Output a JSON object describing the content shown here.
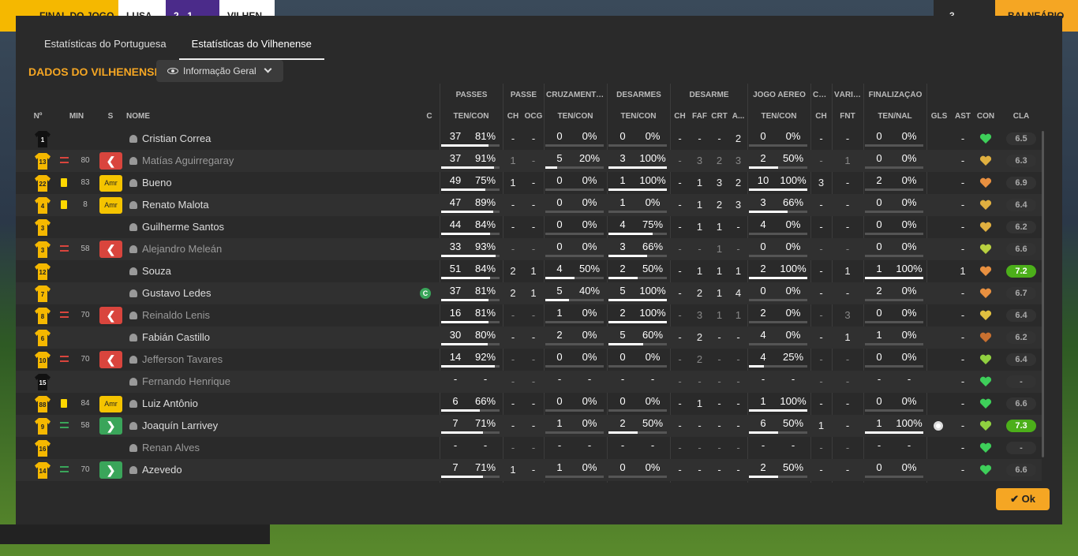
{
  "topbar": {
    "status": "FINAL DO JOGO",
    "home": "LUSA",
    "score": "2 - 1",
    "away": "VILHEN",
    "right_button": "BALNEÁRIO",
    "count": "3"
  },
  "tabs": [
    {
      "label": "Estatísticas do Portuguesa"
    },
    {
      "label": "Estatísticas do Vilhenense"
    }
  ],
  "section_title": "DADOS DO VILHENENSE",
  "view_select": {
    "label": "Informação Geral"
  },
  "ok_label": "Ok",
  "headers": {
    "no": "Nº",
    "min": "MIN",
    "s": "S",
    "nome": "NOME",
    "c": "C",
    "groups": [
      "PASSES",
      "PASSE",
      "CRUZAMENTOS",
      "DESARMES",
      "DESARME",
      "JOGO AÉREO",
      "CA...",
      "VÁRIOS",
      "FINALIZAÇÃO"
    ],
    "sub": [
      "TEN/CON",
      "CH",
      "OCG",
      "TEN/CON",
      "TEN/CON",
      "CH",
      "FAF",
      "CRT",
      "A...",
      "TEN/CON",
      "CH",
      "FNT",
      "TEN/NAL",
      "GLS",
      "AST",
      "CON",
      "CLA"
    ]
  },
  "players": [
    {
      "no": "1",
      "gk": true,
      "sub": "",
      "min": "",
      "s": "",
      "name": "Cristian Correa",
      "dim": false,
      "c": false,
      "pass": [
        "37",
        "81%",
        0.81
      ],
      "ch": "-",
      "ocg": "-",
      "cross": [
        "0",
        "0%",
        0
      ],
      "tack": [
        "0",
        "0%",
        0
      ],
      "dch": "-",
      "faf": "-",
      "crt": "-",
      "a": "2",
      "air": [
        "0",
        "0%",
        0
      ],
      "ca": "-",
      "fnt": "-",
      "fin": [
        "0",
        "0%",
        0
      ],
      "gls": "",
      "ast": "-",
      "con": "#3ecf5a",
      "cla": "6.5",
      "hi": false
    },
    {
      "no": "13",
      "gk": false,
      "sub": "out",
      "min": "80",
      "s": "out",
      "name": "Matías Aguirregaray",
      "dim": true,
      "c": false,
      "pass": [
        "37",
        "91%",
        0.91
      ],
      "ch": "1",
      "ocg": "-",
      "cross": [
        "5",
        "20%",
        0.2
      ],
      "tack": [
        "3",
        "100%",
        1
      ],
      "dch": "-",
      "faf": "3",
      "crt": "2",
      "a": "3",
      "air": [
        "2",
        "50%",
        0.5
      ],
      "ca": "-",
      "fnt": "1",
      "fin": [
        "0",
        "0%",
        0
      ],
      "gls": "",
      "ast": "-",
      "con": "#e0b040",
      "cla": "6.3",
      "hi": false
    },
    {
      "no": "22",
      "gk": false,
      "sub": "yellow",
      "min": "83",
      "s": "amr",
      "name": "Bueno",
      "dim": false,
      "c": false,
      "pass": [
        "49",
        "75%",
        0.75
      ],
      "ch": "1",
      "ocg": "-",
      "cross": [
        "0",
        "0%",
        0
      ],
      "tack": [
        "1",
        "100%",
        1
      ],
      "dch": "-",
      "faf": "1",
      "crt": "3",
      "a": "2",
      "air": [
        "10",
        "100%",
        1
      ],
      "ca": "3",
      "fnt": "-",
      "fin": [
        "2",
        "0%",
        0
      ],
      "gls": "",
      "ast": "-",
      "con": "#e89040",
      "cla": "6.9",
      "hi": false
    },
    {
      "no": "4",
      "gk": false,
      "sub": "yellow",
      "min": "8",
      "s": "amr",
      "name": "Renato Malota",
      "dim": false,
      "c": false,
      "pass": [
        "47",
        "89%",
        0.89
      ],
      "ch": "-",
      "ocg": "-",
      "cross": [
        "0",
        "0%",
        0
      ],
      "tack": [
        "1",
        "0%",
        0
      ],
      "dch": "-",
      "faf": "1",
      "crt": "2",
      "a": "3",
      "air": [
        "3",
        "66%",
        0.66
      ],
      "ca": "-",
      "fnt": "-",
      "fin": [
        "0",
        "0%",
        0
      ],
      "gls": "",
      "ast": "-",
      "con": "#e0b040",
      "cla": "6.4",
      "hi": false
    },
    {
      "no": "3",
      "gk": false,
      "sub": "",
      "min": "",
      "s": "",
      "name": "Guilherme Santos",
      "dim": false,
      "c": false,
      "pass": [
        "44",
        "84%",
        0.84
      ],
      "ch": "-",
      "ocg": "-",
      "cross": [
        "0",
        "0%",
        0
      ],
      "tack": [
        "4",
        "75%",
        0.75
      ],
      "dch": "-",
      "faf": "1",
      "crt": "1",
      "a": "-",
      "air": [
        "4",
        "0%",
        0
      ],
      "ca": "-",
      "fnt": "-",
      "fin": [
        "0",
        "0%",
        0
      ],
      "gls": "",
      "ast": "-",
      "con": "#e0b040",
      "cla": "6.2",
      "hi": false
    },
    {
      "no": "3",
      "gk": false,
      "sub": "out",
      "min": "58",
      "s": "out",
      "name": "Alejandro Meleán",
      "dim": true,
      "c": false,
      "pass": [
        "33",
        "93%",
        0.93
      ],
      "ch": "-",
      "ocg": "-",
      "cross": [
        "0",
        "0%",
        0
      ],
      "tack": [
        "3",
        "66%",
        0.66
      ],
      "dch": "-",
      "faf": "-",
      "crt": "1",
      "a": "-",
      "air": [
        "0",
        "0%",
        0
      ],
      "ca": "-",
      "fnt": "-",
      "fin": [
        "0",
        "0%",
        0
      ],
      "gls": "",
      "ast": "-",
      "con": "#b8d040",
      "cla": "6.6",
      "hi": false
    },
    {
      "no": "12",
      "gk": false,
      "sub": "",
      "min": "",
      "s": "",
      "name": "Souza",
      "dim": false,
      "c": false,
      "pass": [
        "51",
        "84%",
        0.84
      ],
      "ch": "2",
      "ocg": "1",
      "cross": [
        "4",
        "50%",
        0.5
      ],
      "tack": [
        "2",
        "50%",
        0.5
      ],
      "dch": "-",
      "faf": "1",
      "crt": "1",
      "a": "1",
      "air": [
        "2",
        "100%",
        1
      ],
      "ca": "-",
      "fnt": "1",
      "fin": [
        "1",
        "100%",
        1
      ],
      "gls": "",
      "ast": "1",
      "con": "#e89040",
      "cla": "7.2",
      "hi": true
    },
    {
      "no": "7",
      "gk": false,
      "sub": "",
      "min": "",
      "s": "",
      "name": "Gustavo Ledes",
      "dim": false,
      "c": true,
      "pass": [
        "37",
        "81%",
        0.81
      ],
      "ch": "2",
      "ocg": "1",
      "cross": [
        "5",
        "40%",
        0.4
      ],
      "tack": [
        "5",
        "100%",
        1
      ],
      "dch": "-",
      "faf": "2",
      "crt": "1",
      "a": "4",
      "air": [
        "0",
        "0%",
        0
      ],
      "ca": "-",
      "fnt": "-",
      "fin": [
        "2",
        "0%",
        0
      ],
      "gls": "",
      "ast": "-",
      "con": "#e89040",
      "cla": "6.7",
      "hi": false
    },
    {
      "no": "8",
      "gk": false,
      "sub": "out",
      "min": "70",
      "s": "out",
      "name": "Reinaldo Lenis",
      "dim": true,
      "c": false,
      "pass": [
        "16",
        "81%",
        0.81
      ],
      "ch": "-",
      "ocg": "-",
      "cross": [
        "1",
        "0%",
        0
      ],
      "tack": [
        "2",
        "100%",
        1
      ],
      "dch": "-",
      "faf": "3",
      "crt": "1",
      "a": "1",
      "air": [
        "2",
        "0%",
        0
      ],
      "ca": "-",
      "fnt": "3",
      "fin": [
        "0",
        "0%",
        0
      ],
      "gls": "",
      "ast": "-",
      "con": "#e0c040",
      "cla": "6.4",
      "hi": false
    },
    {
      "no": "6",
      "gk": false,
      "sub": "",
      "min": "",
      "s": "",
      "name": "Fabián Castillo",
      "dim": false,
      "c": false,
      "pass": [
        "30",
        "80%",
        0.8
      ],
      "ch": "-",
      "ocg": "-",
      "cross": [
        "2",
        "0%",
        0
      ],
      "tack": [
        "5",
        "60%",
        0.6
      ],
      "dch": "-",
      "faf": "2",
      "crt": "-",
      "a": "-",
      "air": [
        "4",
        "0%",
        0
      ],
      "ca": "-",
      "fnt": "1",
      "fin": [
        "1",
        "0%",
        0
      ],
      "gls": "",
      "ast": "-",
      "con": "#c87030",
      "cla": "6.2",
      "hi": false
    },
    {
      "no": "10",
      "gk": false,
      "sub": "out",
      "min": "70",
      "s": "out",
      "name": "Jefferson Tavares",
      "dim": true,
      "c": false,
      "pass": [
        "14",
        "92%",
        0.92
      ],
      "ch": "-",
      "ocg": "-",
      "cross": [
        "0",
        "0%",
        0
      ],
      "tack": [
        "0",
        "0%",
        0
      ],
      "dch": "-",
      "faf": "2",
      "crt": "-",
      "a": "-",
      "air": [
        "4",
        "25%",
        0.25
      ],
      "ca": "-",
      "fnt": "-",
      "fin": [
        "0",
        "0%",
        0
      ],
      "gls": "",
      "ast": "-",
      "con": "#90d040",
      "cla": "6.4",
      "hi": false
    },
    {
      "no": "15",
      "gk": true,
      "sub": "",
      "min": "",
      "s": "",
      "name": "Fernando Henrique",
      "dim": true,
      "c": false,
      "pass": [
        "-",
        "-",
        -1
      ],
      "ch": "-",
      "ocg": "-",
      "cross": [
        "-",
        "-",
        -1
      ],
      "tack": [
        "-",
        "-",
        -1
      ],
      "dch": "-",
      "faf": "-",
      "crt": "-",
      "a": "-",
      "air": [
        "-",
        "-",
        -1
      ],
      "ca": "-",
      "fnt": "-",
      "fin": [
        "-",
        "-",
        -1
      ],
      "gls": "",
      "ast": "-",
      "con": "#3ecf5a",
      "cla": "-",
      "hi": false
    },
    {
      "no": "88",
      "gk": false,
      "sub": "yellow",
      "min": "84",
      "s": "amr",
      "name": "Luiz Antônio",
      "dim": false,
      "c": false,
      "pass": [
        "6",
        "66%",
        0.66
      ],
      "ch": "-",
      "ocg": "-",
      "cross": [
        "0",
        "0%",
        0
      ],
      "tack": [
        "0",
        "0%",
        0
      ],
      "dch": "-",
      "faf": "1",
      "crt": "-",
      "a": "-",
      "air": [
        "1",
        "100%",
        1
      ],
      "ca": "-",
      "fnt": "-",
      "fin": [
        "0",
        "0%",
        0
      ],
      "gls": "",
      "ast": "-",
      "con": "#3ecf5a",
      "cla": "6.6",
      "hi": false
    },
    {
      "no": "9",
      "gk": false,
      "sub": "in",
      "min": "58",
      "s": "in",
      "name": "Joaquín Larrivey",
      "dim": false,
      "c": false,
      "pass": [
        "7",
        "71%",
        0.71
      ],
      "ch": "-",
      "ocg": "-",
      "cross": [
        "1",
        "0%",
        0
      ],
      "tack": [
        "2",
        "50%",
        0.5
      ],
      "dch": "-",
      "faf": "-",
      "crt": "-",
      "a": "-",
      "air": [
        "6",
        "50%",
        0.5
      ],
      "ca": "1",
      "fnt": "-",
      "fin": [
        "1",
        "100%",
        1
      ],
      "gls": "ball",
      "ast": "-",
      "con": "#90d040",
      "cla": "7.3",
      "hi": true
    },
    {
      "no": "16",
      "gk": false,
      "sub": "",
      "min": "",
      "s": "",
      "name": "Renan Alves",
      "dim": true,
      "c": false,
      "pass": [
        "-",
        "-",
        -1
      ],
      "ch": "-",
      "ocg": "-",
      "cross": [
        "-",
        "-",
        -1
      ],
      "tack": [
        "-",
        "-",
        -1
      ],
      "dch": "-",
      "faf": "-",
      "crt": "-",
      "a": "-",
      "air": [
        "-",
        "-",
        -1
      ],
      "ca": "-",
      "fnt": "-",
      "fin": [
        "-",
        "-",
        -1
      ],
      "gls": "",
      "ast": "-",
      "con": "#3ecf5a",
      "cla": "-",
      "hi": false
    },
    {
      "no": "14",
      "gk": false,
      "sub": "in",
      "min": "70",
      "s": "in",
      "name": "Azevedo",
      "dim": false,
      "c": false,
      "pass": [
        "7",
        "71%",
        0.71
      ],
      "ch": "1",
      "ocg": "-",
      "cross": [
        "1",
        "0%",
        0
      ],
      "tack": [
        "0",
        "0%",
        0
      ],
      "dch": "-",
      "faf": "-",
      "crt": "-",
      "a": "-",
      "air": [
        "2",
        "50%",
        0.5
      ],
      "ca": "-",
      "fnt": "-",
      "fin": [
        "0",
        "0%",
        0
      ],
      "gls": "",
      "ast": "-",
      "con": "#3ecf5a",
      "cla": "6.6",
      "hi": false
    }
  ]
}
